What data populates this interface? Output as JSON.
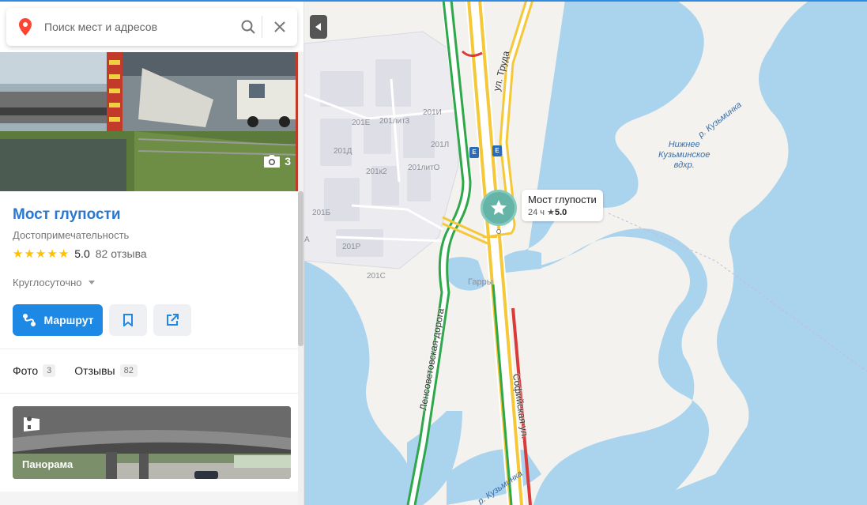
{
  "search": {
    "placeholder": "Поиск мест и адресов"
  },
  "place": {
    "title": "Мост глупости",
    "category": "Достопримечательность",
    "rating": "5.0",
    "reviews_text": "82 отзыва",
    "hours": "Круглосуточно",
    "photo_count": "3"
  },
  "actions": {
    "route_label": "Маршрут",
    "bookmark_icon": "bookmark-icon",
    "share_icon": "share-icon"
  },
  "tabs": [
    {
      "label": "Фото",
      "count": "3"
    },
    {
      "label": "Отзывы",
      "count": "82"
    }
  ],
  "panorama": {
    "label": "Панорама"
  },
  "map": {
    "poi": {
      "name": "Мост глупости",
      "hours": "24 ч",
      "rating": "5.0"
    },
    "streets": {
      "truda": "ул. Труда",
      "sofiyskaya": "Софийская ул.",
      "lensovetovskaya": "Ленсоветовская дорога"
    },
    "water": {
      "kuzminka_top": "р. Кузьминка",
      "reservoir": "Нижнее\nКузьминское\nвдхр.",
      "kuzminka_bottom": "р. Кузьминка"
    },
    "buildings": {
      "b201e": "201Е",
      "b201lit3": "201лит3",
      "b201i": "201И",
      "b201d": "201Д",
      "b201l": "201Л",
      "b201k2": "201к2",
      "b201litO": "201литО",
      "b201b": "201Б",
      "b201r": "201Р",
      "b201s": "201С",
      "garry": "Гарры",
      "edge_a": "А"
    },
    "highway_badge": "E"
  },
  "colors": {
    "accent": "#1e88e5",
    "title": "#2a77d1",
    "water": "#aad3ee",
    "poi": "#64b5a8",
    "traffic_green": "#2ea84a",
    "traffic_yellow": "#f5c83a",
    "traffic_red": "#d93a3a"
  }
}
